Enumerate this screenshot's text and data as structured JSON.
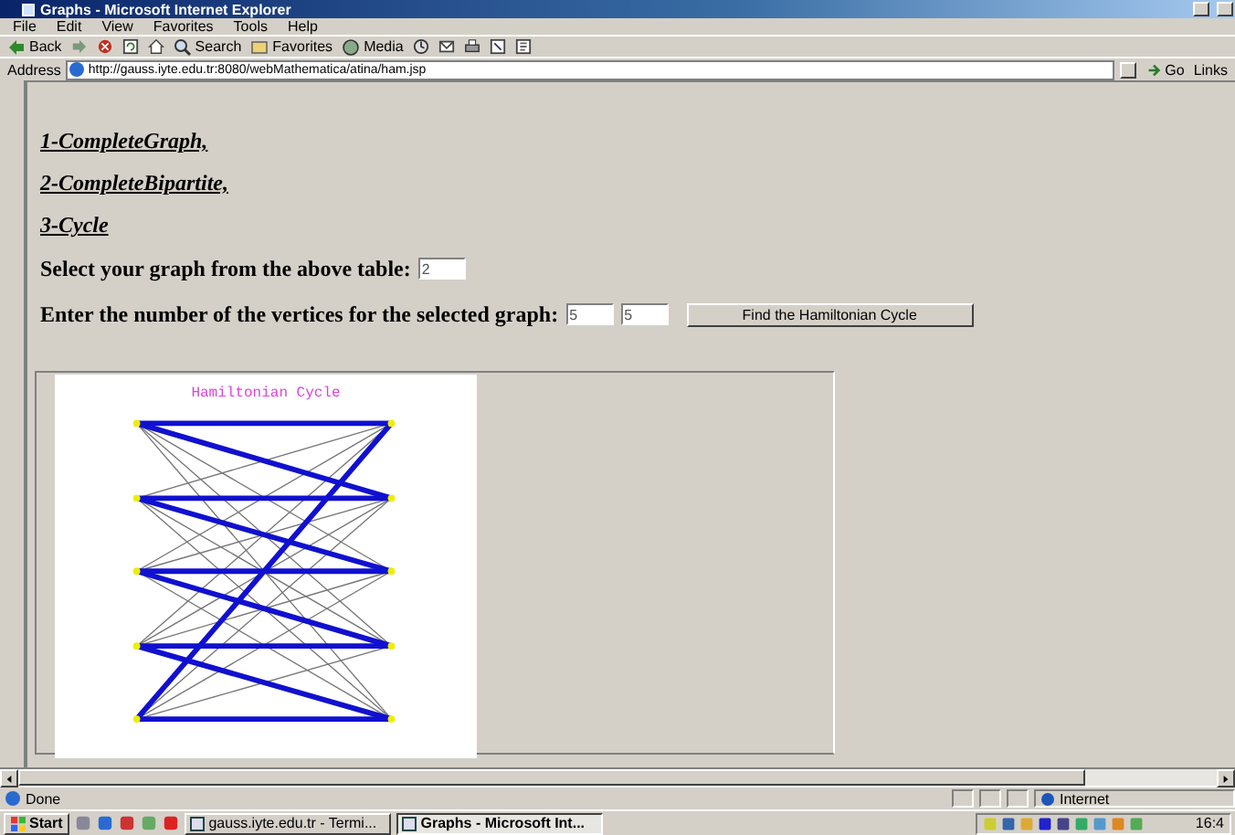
{
  "window": {
    "title": "Graphs - Microsoft Internet Explorer"
  },
  "menu": [
    "File",
    "Edit",
    "View",
    "Favorites",
    "Tools",
    "Help"
  ],
  "toolbar": [
    {
      "kind": "back",
      "label": "Back"
    },
    {
      "kind": "forward"
    },
    {
      "kind": "stop"
    },
    {
      "kind": "refresh"
    },
    {
      "kind": "home"
    },
    {
      "kind": "search",
      "label": "Search"
    },
    {
      "kind": "favorites",
      "label": "Favorites"
    },
    {
      "kind": "media",
      "label": "Media"
    },
    {
      "kind": "history"
    },
    {
      "kind": "mail"
    },
    {
      "kind": "print"
    },
    {
      "kind": "edit"
    },
    {
      "kind": "discuss"
    }
  ],
  "address": {
    "label": "Address",
    "url": "http://gauss.iyte.edu.tr:8080/webMathematica/atina/ham.jsp",
    "go": "Go",
    "links": "Links"
  },
  "page": {
    "links": [
      "1-CompleteGraph,",
      "2-CompleteBipartite,",
      "3-Cycle"
    ],
    "select_label": "Select your graph from the above table:",
    "select_value": "2",
    "vertices_label": "Enter the number of the vertices for the selected graph:",
    "vertices_values": [
      "5",
      "5"
    ],
    "button": "Find the Hamiltonian Cycle",
    "graph": {
      "title": "Hamiltonian Cycle"
    }
  },
  "status_bar": {
    "text": "Done",
    "zone": "Internet"
  },
  "taskbar": {
    "start": "Start",
    "tasks": [
      {
        "label": "gauss.iyte.edu.tr - Termi...",
        "selected": false
      },
      {
        "label": "Graphs - Microsoft Int...",
        "selected": true
      }
    ],
    "clock": "16:4"
  }
}
